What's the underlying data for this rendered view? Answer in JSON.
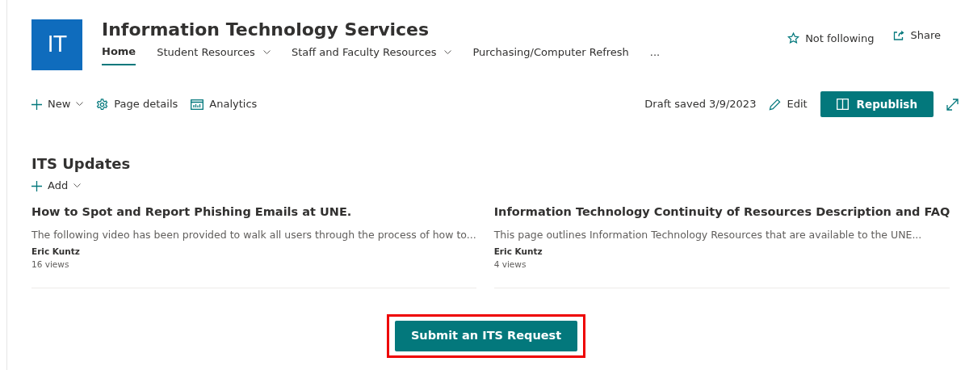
{
  "site": {
    "logo": "IT",
    "title": "Information Technology Services",
    "follow": {
      "label": "Not following",
      "following": false
    },
    "share": "Share"
  },
  "nav": [
    {
      "label": "Home",
      "selected": true,
      "has_menu": false
    },
    {
      "label": "Student Resources",
      "selected": false,
      "has_menu": true
    },
    {
      "label": "Staff and Faculty Resources",
      "selected": false,
      "has_menu": true
    },
    {
      "label": "Purchasing/Computer Refresh",
      "selected": false,
      "has_menu": false
    },
    {
      "label": "...",
      "selected": false,
      "has_menu": false
    }
  ],
  "toolbar": {
    "new": "New",
    "page_details": "Page details",
    "analytics": "Analytics",
    "status": "Draft saved 3/9/2023",
    "edit": "Edit",
    "republish": "Republish"
  },
  "section": {
    "title": "ITS Updates",
    "add": "Add",
    "news": [
      {
        "title": "How to Spot and Report Phishing Emails at UNE.",
        "description": "The following video has been provided to walk all users through the process of how to...",
        "author": "Eric Kuntz",
        "views": "16 views"
      },
      {
        "title": "Information Technology Continuity of Resources Description and FAQ",
        "description": "This page outlines Information Technology Resources that are available to the UNE...",
        "author": "Eric Kuntz",
        "views": "4 views"
      }
    ]
  },
  "request_button": {
    "label": "Submit an ITS Request",
    "highlighted": true
  }
}
